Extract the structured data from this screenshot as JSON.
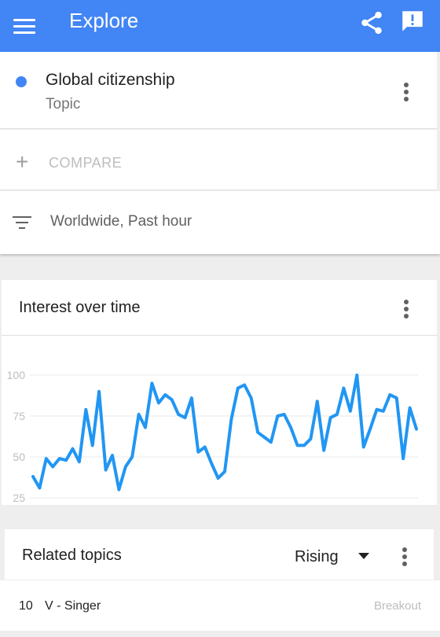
{
  "appbar": {
    "title": "Explore",
    "menu_icon": "menu-icon",
    "share_icon": "share-icon",
    "feedback_icon": "feedback-icon"
  },
  "search_term": {
    "name": "Global citizenship",
    "type": "Topic",
    "color": "#4285f4"
  },
  "compare": {
    "label": "COMPARE"
  },
  "filter": {
    "text": "Worldwide, Past hour"
  },
  "interest_card": {
    "title": "Interest over time"
  },
  "chart_data": {
    "type": "line",
    "title": "",
    "xlabel": "",
    "ylabel": "",
    "ylim": [
      25,
      100
    ],
    "yticks": [
      "100",
      "75",
      "50",
      "25"
    ],
    "grid": true,
    "series": [
      {
        "color": "#2196f3",
        "values": [
          38,
          31,
          49,
          44,
          49,
          48,
          55,
          47,
          79,
          57,
          90,
          42,
          51,
          30,
          44,
          50,
          76,
          68,
          95,
          83,
          88,
          85,
          76,
          74,
          86,
          53,
          56,
          46,
          37,
          41,
          73,
          92,
          94,
          86,
          65,
          62,
          59,
          75,
          76,
          68,
          57,
          57,
          61,
          84,
          54,
          74,
          76,
          92,
          78,
          100,
          56,
          67,
          79,
          78,
          88,
          86,
          49,
          80,
          67
        ]
      }
    ]
  },
  "related": {
    "title": "Related topics",
    "filter_value": "Rising",
    "rows": [
      {
        "rank": "10",
        "name": "V - Singer",
        "status": "Breakout"
      }
    ]
  }
}
